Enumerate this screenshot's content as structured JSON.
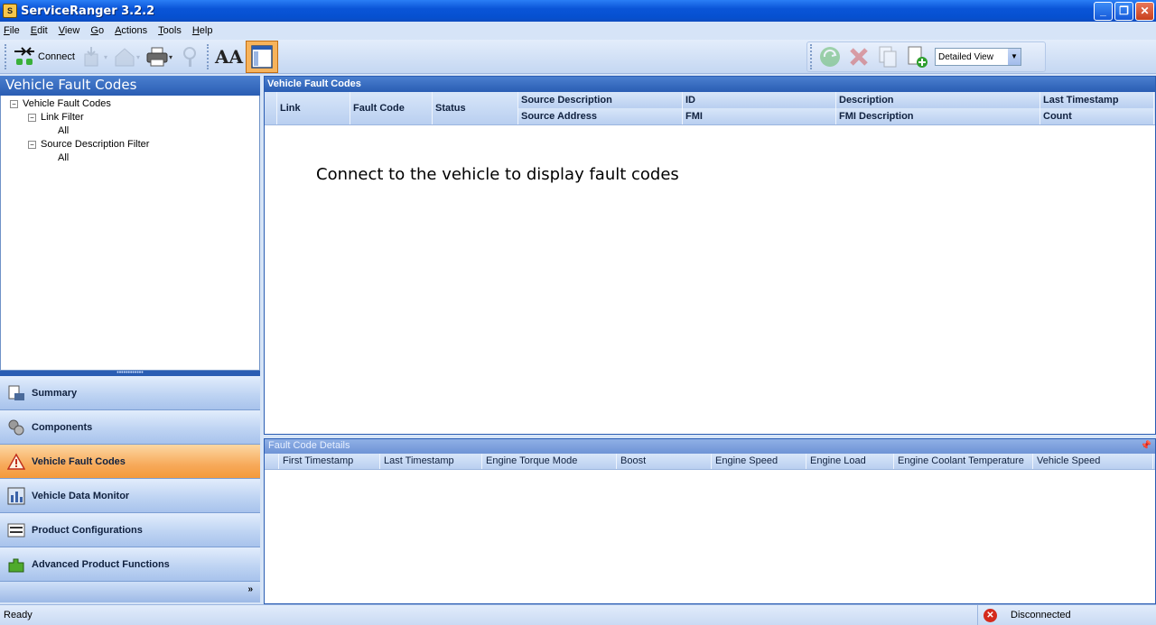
{
  "window": {
    "title": "ServiceRanger 3.2.2",
    "controls": {
      "minimize": "_",
      "maximize": "❐",
      "close": "✕"
    }
  },
  "menu": [
    "File",
    "Edit",
    "View",
    "Go",
    "Actions",
    "Tools",
    "Help"
  ],
  "toolbar": {
    "connect_label": "Connect",
    "font_label": "AA",
    "view_select": {
      "value": "Detailed View"
    }
  },
  "left_panel": {
    "title": "Vehicle Fault Codes",
    "tree": {
      "root": "Vehicle Fault Codes",
      "link_filter": "Link Filter",
      "link_all": "All",
      "source_filter": "Source Description Filter",
      "source_all": "All"
    },
    "nav": [
      {
        "label": "Summary",
        "icon": "summary-icon"
      },
      {
        "label": "Components",
        "icon": "gears-icon"
      },
      {
        "label": "Vehicle Fault Codes",
        "icon": "warning-icon",
        "active": true
      },
      {
        "label": "Vehicle Data Monitor",
        "icon": "data-monitor-icon"
      },
      {
        "label": "Product Configurations",
        "icon": "binary-icon"
      },
      {
        "label": "Advanced Product Functions",
        "icon": "puzzle-icon"
      }
    ],
    "footer_chevron": "»"
  },
  "grid": {
    "title": "Vehicle Fault Codes",
    "columns": {
      "link": "Link",
      "fault_code": "Fault Code",
      "status": "Status",
      "source_description": "Source Description",
      "source_address": "Source Address",
      "id": "ID",
      "fmi": "FMI",
      "description": "Description",
      "fmi_description": "FMI Description",
      "last_timestamp": "Last Timestamp",
      "count": "Count"
    },
    "empty_message": "Connect to the vehicle to display fault codes"
  },
  "details": {
    "title": "Fault Code Details",
    "columns": [
      "First Timestamp",
      "Last Timestamp",
      "Engine Torque Mode",
      "Boost",
      "Engine Speed",
      "Engine Load",
      "Engine Coolant Temperature",
      "Vehicle Speed"
    ]
  },
  "status": {
    "text": "Ready",
    "connection": "Disconnected"
  }
}
